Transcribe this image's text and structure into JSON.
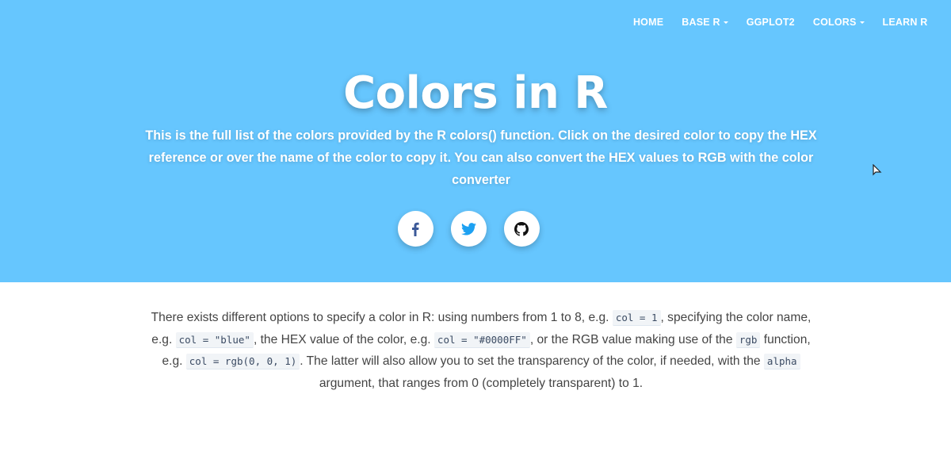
{
  "nav": {
    "items": [
      {
        "label": "HOME",
        "dropdown": false
      },
      {
        "label": "BASE R",
        "dropdown": true
      },
      {
        "label": "GGPLOT2",
        "dropdown": false
      },
      {
        "label": "COLORS",
        "dropdown": true
      },
      {
        "label": "LEARN R",
        "dropdown": false
      }
    ]
  },
  "hero": {
    "title": "Colors in R",
    "subtitle": "This is the full list of the colors provided by the R colors() function. Click on the desired color to copy the HEX reference or over the name of the color to copy it. You can also convert the HEX values to RGB with the color converter",
    "background_color": "#66c6fe"
  },
  "social": {
    "icons": [
      "facebook-icon",
      "twitter-icon",
      "github-icon"
    ],
    "facebook_color": "#3b5998",
    "twitter_color": "#1da1f2",
    "github_color": "#111111"
  },
  "content": {
    "p1": "There exists different options to specify a color in R: using numbers from 1 to 8, e.g. ",
    "code1": "col = 1",
    "p2": ", specifying the color name, e.g. ",
    "code2": "col = \"blue\"",
    "p3": ", the HEX value of the color, e.g. ",
    "code3": "col = \"#0000FF\"",
    "p4": ", or the RGB value making use of the ",
    "code4": "rgb",
    "p5": " function, e.g. ",
    "code5": "col = rgb(0, 0, 1)",
    "p6": ". The latter will also allow you to set the transparency of the color, if needed, with the ",
    "code6": "alpha",
    "p7": " argument, that ranges from 0 (completely transparent) to 1."
  }
}
